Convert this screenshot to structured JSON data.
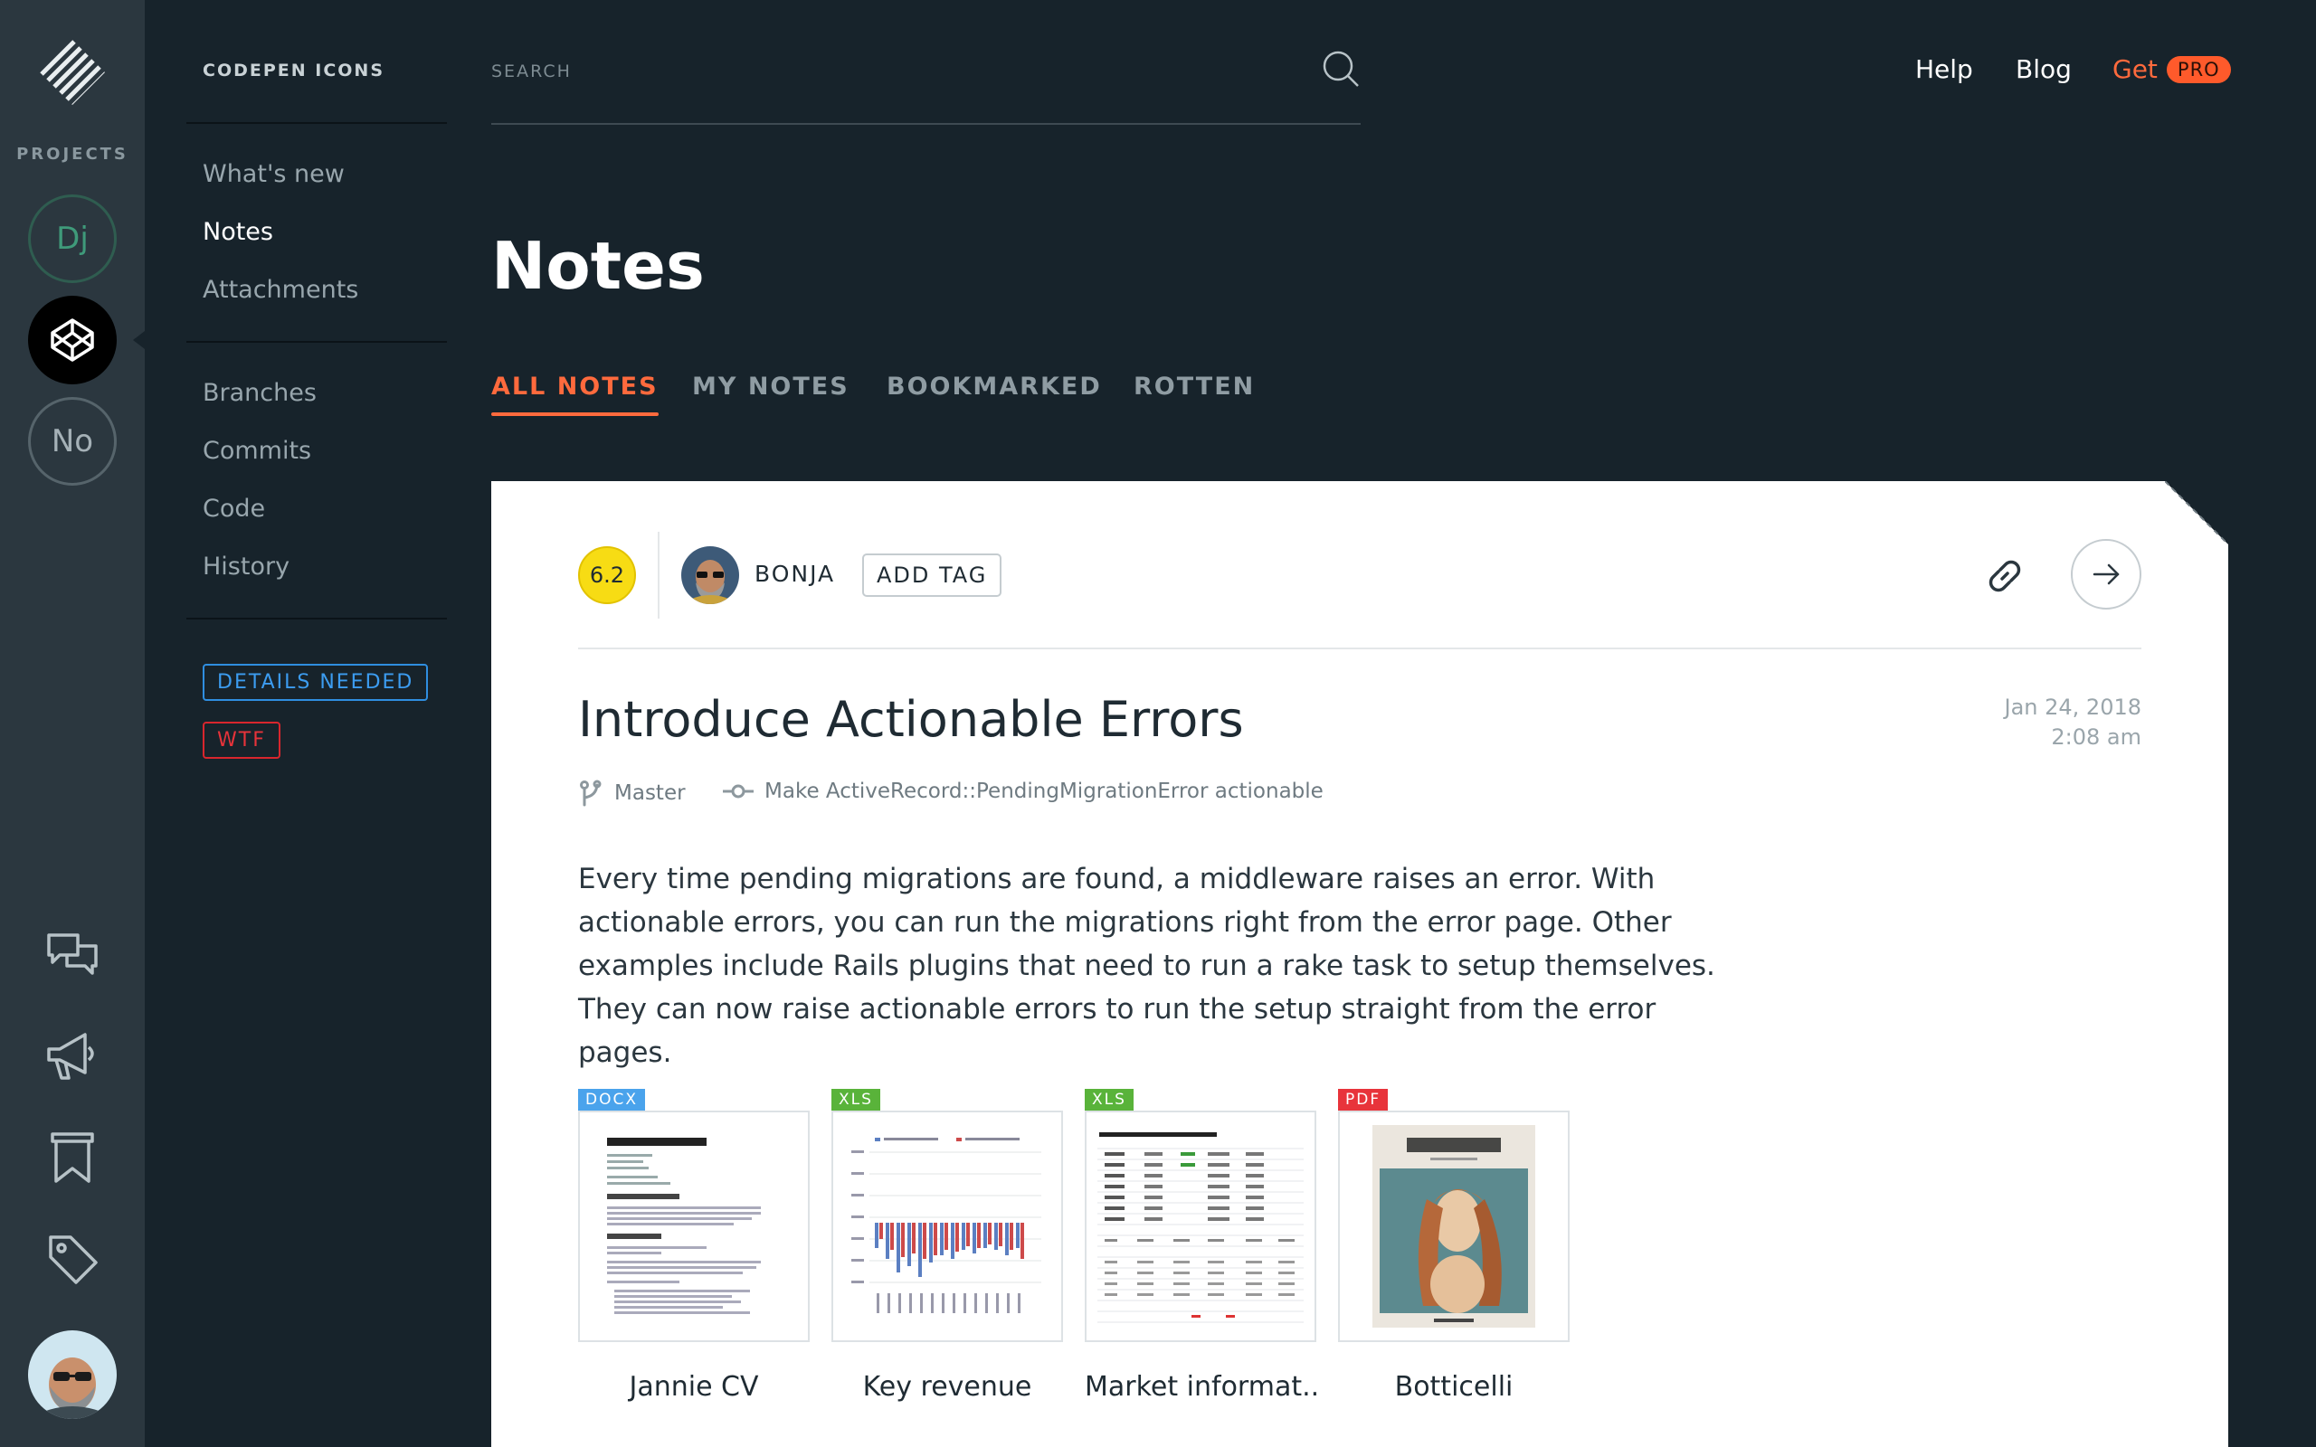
{
  "rail": {
    "projects_label": "PROJECTS",
    "projects": [
      {
        "initials": "Dj"
      },
      {
        "initials": ""
      },
      {
        "initials": "No"
      }
    ],
    "icons": [
      "chat-icon",
      "megaphone-icon",
      "bookmark-icon",
      "tag-icon"
    ]
  },
  "sidenav": {
    "brand": "CODEPEN ICONS",
    "group1": [
      "What's new",
      "Notes",
      "Attachments"
    ],
    "group2": [
      "Branches",
      "Commits",
      "Code",
      "History"
    ],
    "tags": [
      "DETAILS NEEDED",
      "WTF"
    ]
  },
  "search": {
    "placeholder": "SEARCH"
  },
  "topnav": {
    "help": "Help",
    "blog": "Blog",
    "get": "Get",
    "pro": "PRO"
  },
  "page": {
    "title": "Notes"
  },
  "tabs": [
    "ALL NOTES",
    "MY NOTES",
    "BOOKMARKED",
    "ROTTEN"
  ],
  "note": {
    "score": "6.2",
    "author": "BONJA",
    "add_tag": "ADD TAG",
    "title": "Introduce Actionable Errors",
    "date": "Jan 24, 2018",
    "time": "2:08 am",
    "branch": "Master",
    "commit": "Make ActiveRecord::PendingMigrationError actionable",
    "body": "Every time pending migrations are found, a middleware raises an error. With actionable errors, you can run the migrations right from the error page. Other examples include Rails plugins that need to run a rake task to setup themselves. They can now raise actionable errors to run the setup straight from the error pages.",
    "attachments": [
      {
        "type": "DOCX",
        "name": "Jannie CV",
        "color": "#4aa3ec"
      },
      {
        "type": "XLS",
        "name": "Key revenue",
        "color": "#59b33a"
      },
      {
        "type": "XLS",
        "name": "Market informat...",
        "color": "#59b33a"
      },
      {
        "type": "PDF",
        "name": "Botticelli",
        "color": "#e8343b"
      }
    ]
  },
  "colors": {
    "accent": "#ff6a3d",
    "rail_bg": "#2b373f",
    "page_bg": "#17232b",
    "score": "#f7dc14"
  }
}
